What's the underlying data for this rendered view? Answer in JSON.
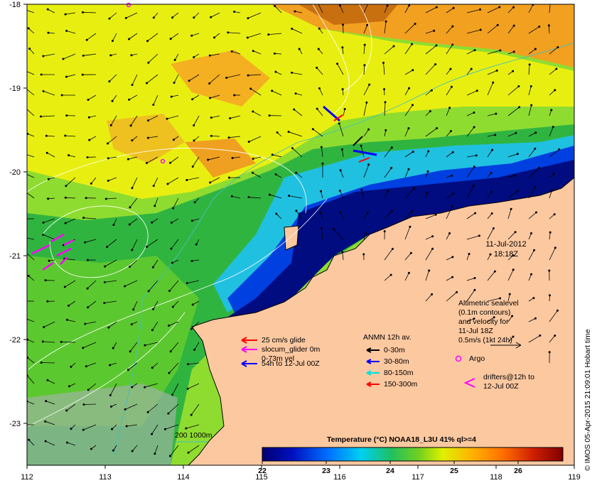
{
  "map": {
    "lon_min": 112,
    "lon_max": 119,
    "lat_min": -23.5,
    "lat_max": -18,
    "x_ticks": [
      112,
      113,
      114,
      115,
      116,
      117,
      118,
      119
    ],
    "y_ticks": [
      -18,
      -19,
      -20,
      -21,
      -22,
      -23
    ],
    "x_tick_labels": [
      "112",
      "113",
      "114",
      "115",
      "116",
      "117",
      "118",
      "119"
    ],
    "y_tick_labels": [
      "-18",
      "-19",
      "-20",
      "-21",
      "-22",
      "-23"
    ]
  },
  "date_label": {
    "line1": "11-Jul-2012",
    "line2": "18:18Z"
  },
  "altimetry_note": [
    "Altimetric sealevel",
    "(0.1m contours)",
    "and velocity for",
    "11-Jul 18Z",
    "0.5m/s (1kt 24h)"
  ],
  "glider_legend": [
    {
      "text": "25 cm/s glide",
      "color": "#ff0000"
    },
    {
      "text": "slocum_glider 0m",
      "color": "#ff00ff"
    },
    {
      "text": "0-73m vel",
      "color": ""
    },
    {
      "text": "54h to 12-Jul 00Z",
      "color": "#0000ff"
    }
  ],
  "anmn_legend": {
    "title": "ANMN 12h av.",
    "items": [
      {
        "text": "0-30m",
        "color": "#000000"
      },
      {
        "text": "30-80m",
        "color": "#0000ff"
      },
      {
        "text": "80-150m",
        "color": "#00e0e0"
      },
      {
        "text": "150-300m",
        "color": "#ff0000"
      }
    ]
  },
  "argo_legend": {
    "text": "Argo",
    "color": "#ff00ff"
  },
  "drifter_legend": {
    "line1": "drifters@12h to",
    "line2": "12-Jul 00Z",
    "color": "#ff00ff"
  },
  "bathy_legend": {
    "text": "200  1000m",
    "color": "#40c0c0"
  },
  "colorbar": {
    "title": "Temperature (°C) NOAA18_L3U 41% ql>=4",
    "min": 22,
    "max": 26.7,
    "ticks": [
      22,
      23,
      24,
      25,
      26
    ],
    "tick_labels": [
      "22",
      "23",
      "24",
      "25",
      "26"
    ]
  },
  "credit": "© IMOS 05-Apr-2015 21:09:01 Hobart time",
  "colors": {
    "land": "#fcc8a0",
    "cold": "#00108a",
    "accent": "#ff00ff"
  }
}
